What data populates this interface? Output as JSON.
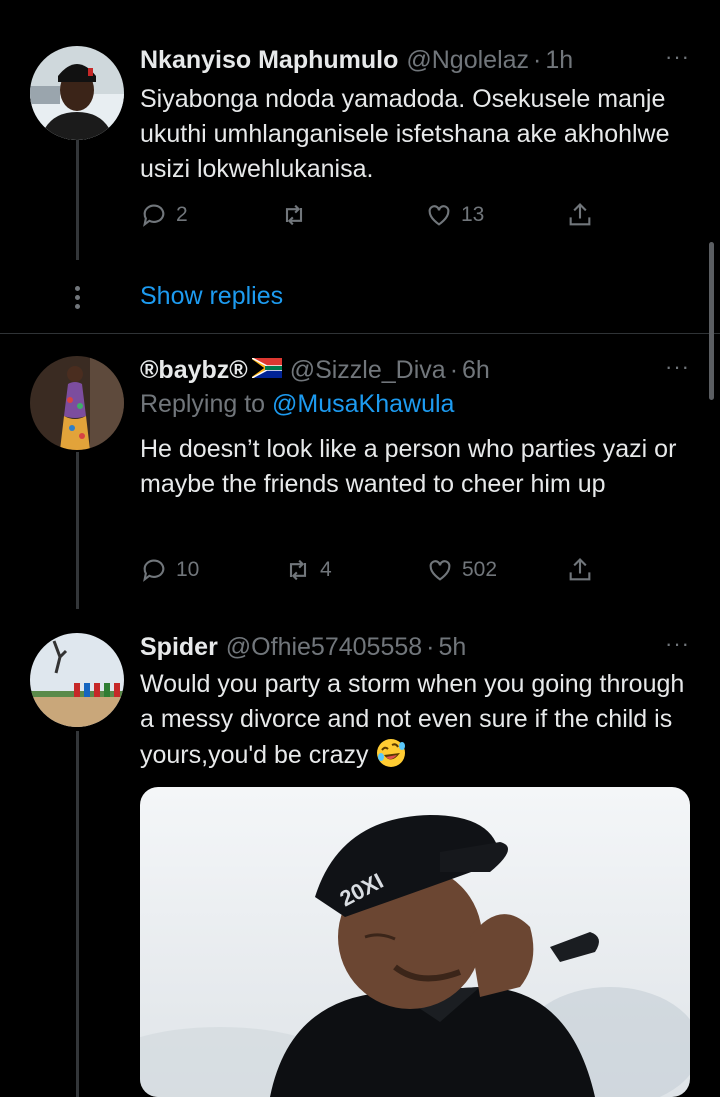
{
  "tweets": [
    {
      "name": "Nkanyiso Maphumulo",
      "handle": "@Ngolelaz",
      "dot": "·",
      "time": "1h",
      "text": "Siyabonga ndoda yamadoda. Osekusele manje ukuthi umhlanganisele isfetshana ake akhohlwe usizi lokwehlukanisa.",
      "replies": "2",
      "retweets": "",
      "likes": "13",
      "show_replies": "Show replies"
    },
    {
      "name": "®baybz®",
      "handle": "@Sizzle_Diva",
      "dot": "·",
      "time": "6h",
      "replying_prefix": "Replying to",
      "replying_to": "@MusaKhawula",
      "text": "He doesn’t look like a person who parties yazi or maybe the friends wanted to cheer him up",
      "replies": "10",
      "retweets": "4",
      "likes": "502"
    },
    {
      "name": "Spider",
      "handle": "@Ofhie57405558",
      "dot": "·",
      "time": "5h",
      "text": "Would you party a storm when you going through a messy divorce and not even sure if the child is yours,you'd be crazy",
      "emoji": "rolling-on-floor-laughing-emoji",
      "media_cap_text": "20XI"
    }
  ],
  "more_glyph": "···",
  "colors": {
    "background": "#000000",
    "text": "#e7e9ea",
    "secondary": "#71767b",
    "link": "#1d9bf0",
    "divider": "#2f3336"
  }
}
